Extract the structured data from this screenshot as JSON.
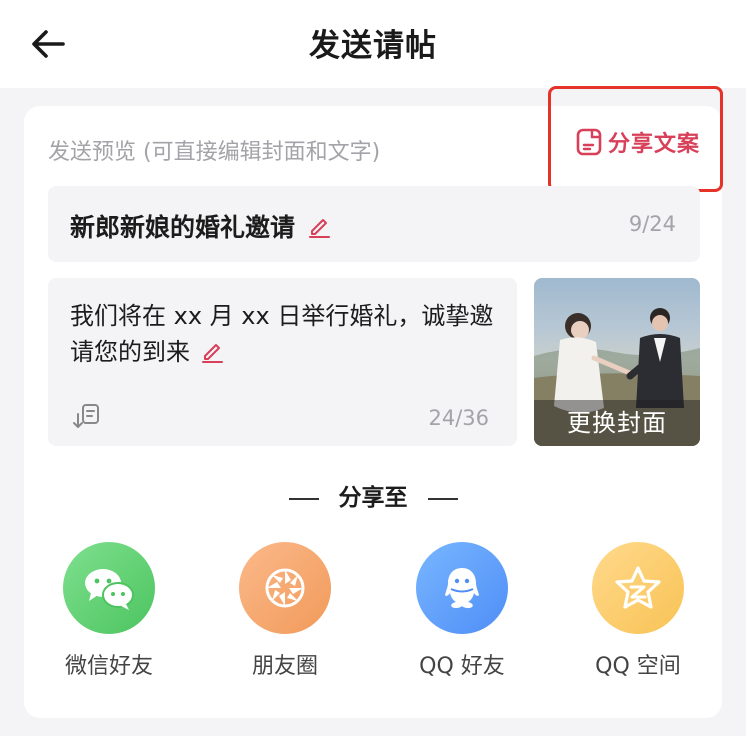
{
  "header": {
    "title": "发送请帖"
  },
  "card": {
    "preview_label": "发送预览 (可直接编辑封面和文字)",
    "share_copy_label": "分享文案",
    "title_field": {
      "value": "新郎新娘的婚礼邀请",
      "count": "9/24"
    },
    "body_field": {
      "value": "我们将在 xx 月 xx 日举行婚礼，诚挚邀请您的到来",
      "count": "24/36"
    },
    "cover": {
      "button_label": "更换封面"
    },
    "share_section_label": "分享至",
    "share_targets": [
      {
        "label": "微信好友",
        "icon": "wechat-icon"
      },
      {
        "label": "朋友圈",
        "icon": "moments-icon"
      },
      {
        "label": "QQ 好友",
        "icon": "qq-icon"
      },
      {
        "label": "QQ 空间",
        "icon": "qzone-icon"
      }
    ]
  },
  "colors": {
    "accent": "#d8405a",
    "highlight_border": "#e5332a"
  }
}
